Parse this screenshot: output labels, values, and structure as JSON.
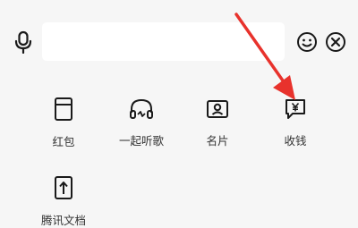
{
  "input_bar": {
    "voice_icon": "microphone-icon",
    "placeholder": "",
    "value": "",
    "emoji_icon": "smiley-icon",
    "close_icon": "close-circle-icon"
  },
  "panel": {
    "items": [
      {
        "label": "红包",
        "icon": "red-packet-icon"
      },
      {
        "label": "一起听歌",
        "icon": "headphones-icon"
      },
      {
        "label": "名片",
        "icon": "contact-card-icon"
      },
      {
        "label": "收钱",
        "icon": "receive-money-icon"
      },
      {
        "label": "腾讯文档",
        "icon": "tencent-docs-icon"
      }
    ]
  },
  "annotation": {
    "arrow_color": "#e8322c"
  }
}
